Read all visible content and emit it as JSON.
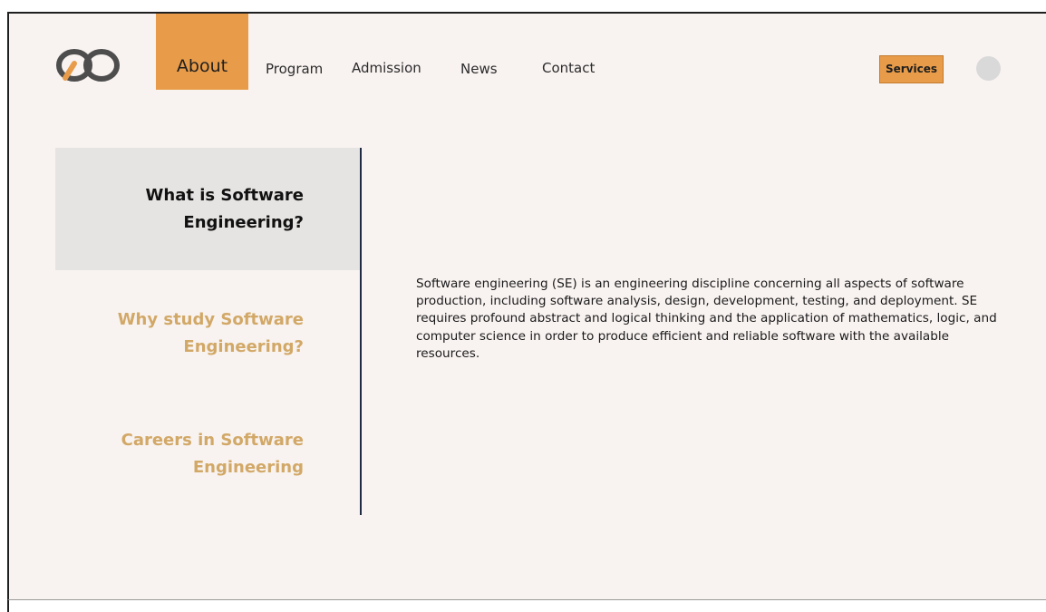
{
  "nav": {
    "logo": "logo-icon",
    "items": [
      "About",
      "Program",
      "Admission",
      "News",
      "Contact"
    ],
    "active": "About",
    "services_label": "Services"
  },
  "sidebar": {
    "items": [
      {
        "line1": "What is Software",
        "line2": "Engineering?",
        "active": true
      },
      {
        "line1": "Why study Software",
        "line2": "Engineering?",
        "active": false
      },
      {
        "line1": "Careers in Software",
        "line2": "Engineering",
        "active": false
      }
    ]
  },
  "content": {
    "text": "Software engineering (SE) is an engineering discipline concerning all aspects of software production, including software analysis, design, development, testing, and deployment. SE requires profound abstract and logical thinking and the application of mathematics, logic, and computer science in order to produce efficient and reliable software with the available resources."
  },
  "colors": {
    "accent": "#e89c4a",
    "background": "#f8f3f1",
    "inactive_text": "#d2a867",
    "divider": "#1f2a44"
  }
}
